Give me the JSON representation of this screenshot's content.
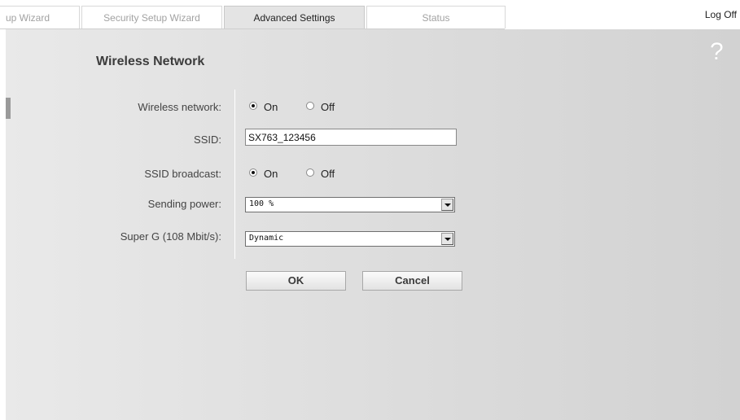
{
  "tabs": [
    {
      "label": "up Wizard",
      "active": false
    },
    {
      "label": "Security Setup Wizard",
      "active": false
    },
    {
      "label": "Advanced Settings",
      "active": true
    },
    {
      "label": "Status",
      "active": false
    }
  ],
  "header": {
    "logoff_label": "Log Off",
    "help_symbol": "?"
  },
  "page": {
    "title": "Wireless Network"
  },
  "form": {
    "wireless_network": {
      "label": "Wireless network:",
      "on_label": "On",
      "off_label": "Off",
      "selected": "On"
    },
    "ssid": {
      "label": "SSID:",
      "value": "SX763_123456"
    },
    "ssid_broadcast": {
      "label": "SSID broadcast:",
      "on_label": "On",
      "off_label": "Off",
      "selected": "On"
    },
    "sending_power": {
      "label": "Sending power:",
      "value": "100 %"
    },
    "super_g": {
      "label": "Super G (108 Mbit/s):",
      "value": "Dynamic"
    }
  },
  "buttons": {
    "ok_label": "OK",
    "cancel_label": "Cancel"
  },
  "icons": {
    "help": "help-icon",
    "select_arrow": "chevron-down-icon"
  },
  "colors": {
    "panel_bg": "#dcdcdc",
    "active_tab_bg": "#e4e4e4",
    "inactive_tab_text": "#a2a2a2"
  }
}
